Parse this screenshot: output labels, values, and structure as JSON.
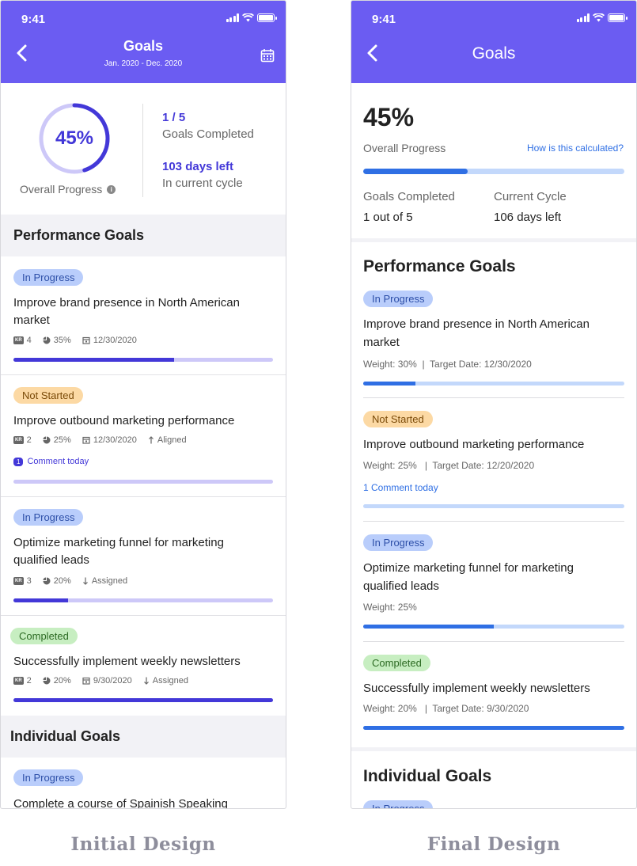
{
  "initial": {
    "status_time": "9:41",
    "title": "Goals",
    "subtitle": "Jan. 2020 - Dec. 2020",
    "overview": {
      "percent": "45%",
      "percent_value": 45,
      "overall_label": "Overall Progress",
      "goals_fraction": "1 / 5",
      "goals_label": "Goals Completed",
      "days_left": "103 days left",
      "cycle_label": "In current cycle"
    },
    "performance_section": "Performance Goals",
    "individual_section": "Individual Goals",
    "goals": [
      {
        "status": "In Progress",
        "title_line1": "Improve brand presence in North American",
        "title_line2": "market",
        "kr": "4",
        "weight": "35%",
        "date": "12/30/2020",
        "extra": "",
        "comment_count": "",
        "comment": "",
        "progress": 62
      },
      {
        "status": "Not Started",
        "title_line1": "Improve outbound marketing performance",
        "title_line2": "",
        "kr": "2",
        "weight": "25%",
        "date": "12/30/2020",
        "extra": "Aligned",
        "comment_count": "1",
        "comment": "Comment today",
        "progress": 0
      },
      {
        "status": "In Progress",
        "title_line1": "Optimize marketing funnel for marketing",
        "title_line2": "qualified leads",
        "kr": "3",
        "weight": "20%",
        "date": "",
        "extra": "Assigned",
        "comment_count": "",
        "comment": "",
        "progress": 21
      },
      {
        "status": "Completed",
        "title_line1": "Successfully implement weekly newsletters",
        "title_line2": "",
        "kr": "2",
        "weight": "20%",
        "date": "9/30/2020",
        "extra": "Assigned",
        "comment_count": "",
        "comment": "",
        "progress": 100
      }
    ],
    "individual_first": {
      "status": "In Progress",
      "title": "Complete a course of Spainish Speaking"
    }
  },
  "final": {
    "status_time": "9:41",
    "title": "Goals",
    "overview": {
      "percent": "45%",
      "overall_label": "Overall Progress",
      "how_link": "How is this calculated?",
      "progress": 40,
      "goals_label": "Goals Completed",
      "goals_value": "1 out of 5",
      "cycle_label": "Current Cycle",
      "cycle_value": "106 days left"
    },
    "performance_section": "Performance Goals",
    "individual_section": "Individual Goals",
    "goals": [
      {
        "status": "In Progress",
        "title_line1": "Improve brand presence in North American",
        "title_line2": "market",
        "meta": "Weight: 30%  |  Target Date: 12/30/2020",
        "comment": "",
        "progress": 20
      },
      {
        "status": "Not Started",
        "title_line1": "Improve outbound marketing performance",
        "title_line2": "",
        "meta": "Weight: 25%   |  Target Date: 12/20/2020",
        "comment": "1 Comment today",
        "progress": 0
      },
      {
        "status": "In Progress",
        "title_line1": "Optimize marketing funnel for marketing",
        "title_line2": "qualified leads",
        "meta": "Weight: 25%",
        "comment": "",
        "progress": 50
      },
      {
        "status": "Completed",
        "title_line1": "Successfully implement weekly newsletters",
        "title_line2": "",
        "meta": "Weight: 20%   |  Target Date: 9/30/2020",
        "comment": "",
        "progress": 100
      }
    ],
    "individual_first_status": "In Progress"
  },
  "labels": {
    "initial_design": "Initial Design",
    "final_design": "Final Design"
  },
  "colors": {
    "header_purple": "#6b5cf2",
    "initial_bar": "#4338d8",
    "initial_track": "#cdc8f8",
    "final_bar": "#2f6fe4",
    "final_track": "#c3d8fb",
    "link_blue": "#2f6fe4"
  },
  "icons": [
    "signal-icon",
    "wifi-icon",
    "battery-icon",
    "back-icon",
    "calendar-icon",
    "info-icon",
    "kr-icon",
    "pie-icon",
    "date-icon",
    "aligned-icon",
    "assigned-icon"
  ]
}
